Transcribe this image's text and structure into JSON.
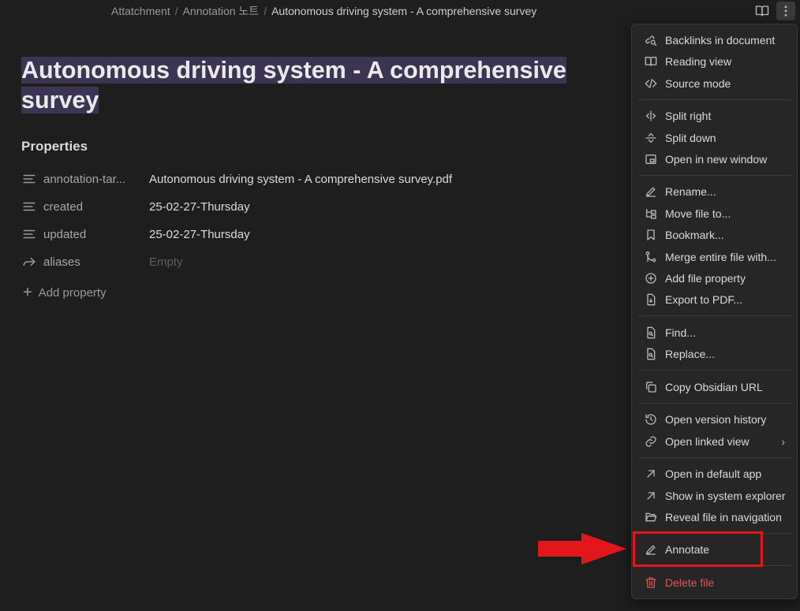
{
  "breadcrumb": {
    "items": [
      "Attatchment",
      "Annotation 노트"
    ],
    "separator": "/",
    "current": "Autonomous driving system - A comprehensive survey"
  },
  "title": {
    "line1": "Autonomous driving system - A comprehensive",
    "line2": "survey"
  },
  "properties": {
    "heading": "Properties",
    "rows": [
      {
        "icon": "text-lines-icon",
        "key": "annotation-tar...",
        "value": "Autonomous driving system - A comprehensive survey.pdf",
        "empty": false
      },
      {
        "icon": "text-lines-icon",
        "key": "created",
        "value": "25-02-27-Thursday",
        "empty": false
      },
      {
        "icon": "text-lines-icon",
        "key": "updated",
        "value": "25-02-27-Thursday",
        "empty": false
      },
      {
        "icon": "forward-arrow-icon",
        "key": "aliases",
        "value": "Empty",
        "empty": true
      }
    ],
    "add_label": "Add property"
  },
  "menu": {
    "backlinks": "Backlinks in document",
    "reading_view": "Reading view",
    "source_mode": "Source mode",
    "split_right": "Split right",
    "split_down": "Split down",
    "open_new_window": "Open in new window",
    "rename": "Rename...",
    "move_file": "Move file to...",
    "bookmark": "Bookmark...",
    "merge": "Merge entire file with...",
    "add_property": "Add file property",
    "export_pdf": "Export to PDF...",
    "find": "Find...",
    "replace": "Replace...",
    "copy_url": "Copy Obsidian URL",
    "version_history": "Open version history",
    "linked_view": "Open linked view",
    "default_app": "Open in default app",
    "system_explorer": "Show in system explorer",
    "reveal_nav": "Reveal file in navigation",
    "annotate": "Annotate",
    "delete": "Delete file"
  },
  "colors": {
    "background": "#1e1e1e",
    "menu_background": "#262626",
    "title_highlight": "#3b3452",
    "danger": "#e0544f",
    "annotation_red": "#e4161b"
  }
}
